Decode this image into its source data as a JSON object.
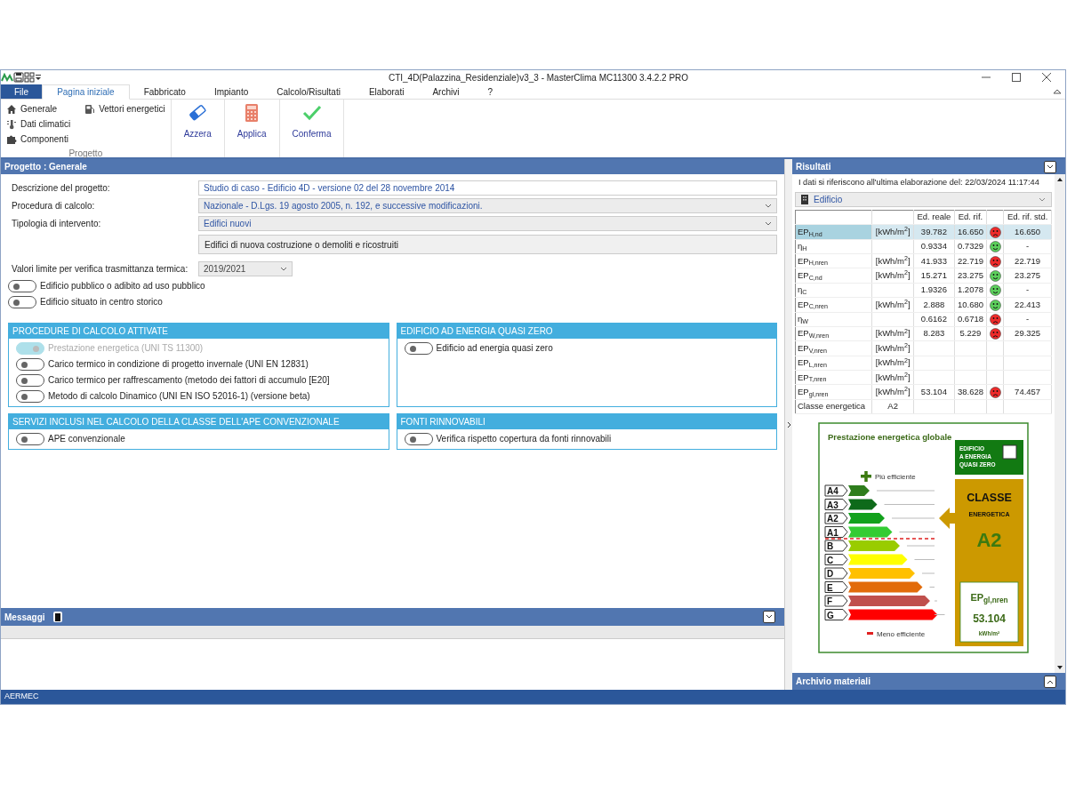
{
  "window": {
    "title": "CTI_4D(Palazzina_Residenziale)v3_3 - MasterClima MC11300 3.4.2.2 PRO"
  },
  "ribbon_tabs": [
    {
      "label": "File",
      "selected": false,
      "kind": "file"
    },
    {
      "label": "Pagina iniziale",
      "selected": true,
      "kind": "tab"
    },
    {
      "label": "Fabbricato",
      "selected": false,
      "kind": "tab"
    },
    {
      "label": "Impianto",
      "selected": false,
      "kind": "tab"
    },
    {
      "label": "Calcolo/Risultati",
      "selected": false,
      "kind": "tab"
    },
    {
      "label": "Elaborati",
      "selected": false,
      "kind": "tab"
    },
    {
      "label": "Archivi",
      "selected": false,
      "kind": "tab"
    },
    {
      "label": "?",
      "selected": false,
      "kind": "tab"
    }
  ],
  "ribbon": {
    "group_label": "Progetto",
    "small_items": [
      {
        "label": "Generale"
      },
      {
        "label": "Dati climatici"
      },
      {
        "label": "Componenti"
      },
      {
        "label": "Vettori energetici"
      }
    ],
    "large_buttons": [
      {
        "label": "Azzera"
      },
      {
        "label": "Applica"
      },
      {
        "label": "Conferma"
      }
    ]
  },
  "project_panel": {
    "title": "Progetto : Generale",
    "fields": [
      {
        "label": "Descrizione del progetto:",
        "value": "Studio di caso - Edificio 4D - versione 02 del 28 novembre 2014",
        "kind": "text"
      },
      {
        "label": "Procedura di calcolo:",
        "value": "Nazionale - D.Lgs. 19 agosto 2005, n. 192, e successive modificazioni.",
        "kind": "select"
      },
      {
        "label": "Tipologia di intervento:",
        "value": "Edifici nuovi",
        "kind": "select"
      }
    ],
    "intervention_note": "Edifici di nuova costruzione o demoliti e ricostruiti",
    "limit_values": {
      "label": "Valori limite per verifica trasmittanza termica:",
      "value": "2019/2021"
    },
    "toggles": [
      {
        "label": "Edificio pubblico o adibito ad uso pubblico",
        "on": false
      },
      {
        "label": "Edificio situato in centro storico",
        "on": false
      }
    ],
    "sections": [
      {
        "title": "PROCEDURE DI CALCOLO ATTIVATE",
        "toggles": [
          {
            "label": "Prestazione energetica (UNI TS 11300)",
            "on": true,
            "disabled": true
          },
          {
            "label": "Carico termico in condizione di progetto invernale (UNI EN 12831)",
            "on": false,
            "disabled": false
          },
          {
            "label": "Carico termico per raffrescamento (metodo dei fattori di accumulo [E20]",
            "on": false,
            "disabled": false
          },
          {
            "label": "Metodo di calcolo Dinamico (UNI EN ISO 52016-1) (versione beta)",
            "on": false,
            "disabled": false
          }
        ]
      },
      {
        "title": "EDIFICIO AD ENERGIA QUASI ZERO",
        "toggles": [
          {
            "label": "Edificio ad energia quasi zero",
            "on": false,
            "disabled": false
          }
        ]
      },
      {
        "title": "SERVIZI INCLUSI NEL CALCOLO DELLA CLASSE DELL'APE CONVENZIONALE",
        "toggles": [
          {
            "label": "APE convenzionale",
            "on": false,
            "disabled": false
          }
        ]
      },
      {
        "title": "FONTI RINNOVABILI",
        "toggles": [
          {
            "label": "Verifica rispetto copertura da fonti rinnovabili",
            "on": false,
            "disabled": false
          }
        ]
      }
    ]
  },
  "messages_panel": {
    "title": "Messaggi"
  },
  "results_panel": {
    "title": "Risultati",
    "note": "I dati si riferiscono all'ultima elaborazione del: 22/03/2024 11:17:44",
    "selector": "Edificio",
    "columns": [
      "Ed. reale",
      "Ed. rif.",
      "Ed. rif. std."
    ],
    "rows": [
      {
        "name": "EP$_{H,nd}$",
        "unit": "[kWh/m$^{2}$]",
        "real": "39.782",
        "ref": "16.650",
        "ok": false,
        "std": "16.650",
        "selected": true
      },
      {
        "name": "η$_{H}$",
        "real": "0.9334",
        "ref": "0.7329",
        "ok": true,
        "std": "-",
        "selected": false
      },
      {
        "name": "EP$_{H,nren}$",
        "unit": "[kWh/m$^{2}$]",
        "real": "41.933",
        "ref": "22.719",
        "ok": false,
        "std": "22.719",
        "selected": false
      },
      {
        "name": "EP$_{C,nd}$",
        "unit": "[kWh/m$^{2}$]",
        "real": "15.271",
        "ref": "23.275",
        "ok": true,
        "std": "23.275",
        "selected": false
      },
      {
        "name": "η$_{C}$",
        "real": "1.9326",
        "ref": "1.2078",
        "ok": true,
        "std": "-",
        "selected": false
      },
      {
        "name": "EP$_{C,nren}$",
        "unit": "[kWh/m$^{2}$]",
        "real": "2.888",
        "ref": "10.680",
        "ok": true,
        "std": "22.413",
        "selected": false
      },
      {
        "name": "η$_{W}$",
        "real": "0.6162",
        "ref": "0.6718",
        "ok": false,
        "std": "-",
        "selected": false
      },
      {
        "name": "EP$_{W,nren}$",
        "unit": "[kWh/m$^{2}$]",
        "real": "8.283",
        "ref": "5.229",
        "ok": false,
        "std": "29.325",
        "selected": false
      },
      {
        "name": "EP$_{V,nren}$",
        "unit": "[kWh/m$^{2}$]",
        "selected": false
      },
      {
        "name": "EP$_{L,nren}$",
        "unit": "[kWh/m$^{2}$]",
        "selected": false
      },
      {
        "name": "EP$_{T,nren}$",
        "unit": "[kWh/m$^{2}$]",
        "selected": false
      },
      {
        "name": "EP$_{gl,nren}$",
        "unit": "[kWh/m$^{2}$]",
        "real": "53.104",
        "ref": "38.628",
        "ok": false,
        "std": "74.457",
        "selected": false
      },
      {
        "name": "Classe energetica",
        "unit": "A2",
        "selected": false
      }
    ],
    "label": {
      "title": "Prestazione energetica globale",
      "more_efficient": "Più efficiente",
      "less_efficient": "Meno efficiente",
      "nzeb_lines": [
        "EDIFICIO",
        "A ENERGIA",
        "QUASI ZERO"
      ],
      "nzeb_checked": false,
      "class_title": "CLASSE",
      "class_subtitle": "ENERGETICA",
      "class_value": "A2",
      "ep_label": "EP$_{gl,nren}$",
      "ep_value": "53.104",
      "ep_unit": "kWh/m²",
      "classes": [
        {
          "label": "A4",
          "color": "#2e7d1c",
          "selected": false
        },
        {
          "label": "A3",
          "color": "#0e6a1a",
          "selected": false
        },
        {
          "label": "A2",
          "color": "#12a11c",
          "selected": true
        },
        {
          "label": "A1",
          "color": "#33cc33",
          "selected": false
        },
        {
          "label": "B",
          "color": "#99cc00",
          "selected": false
        },
        {
          "label": "C",
          "color": "#ffff00",
          "selected": false
        },
        {
          "label": "D",
          "color": "#ffc000",
          "selected": false
        },
        {
          "label": "E",
          "color": "#e26b0a",
          "selected": false
        },
        {
          "label": "F",
          "color": "#c0504d",
          "selected": false
        },
        {
          "label": "G",
          "color": "#ff0000",
          "selected": false
        }
      ]
    }
  },
  "materials_panel": {
    "title": "Archivio materiali"
  },
  "status_bar": {
    "text": "AERMEC"
  }
}
